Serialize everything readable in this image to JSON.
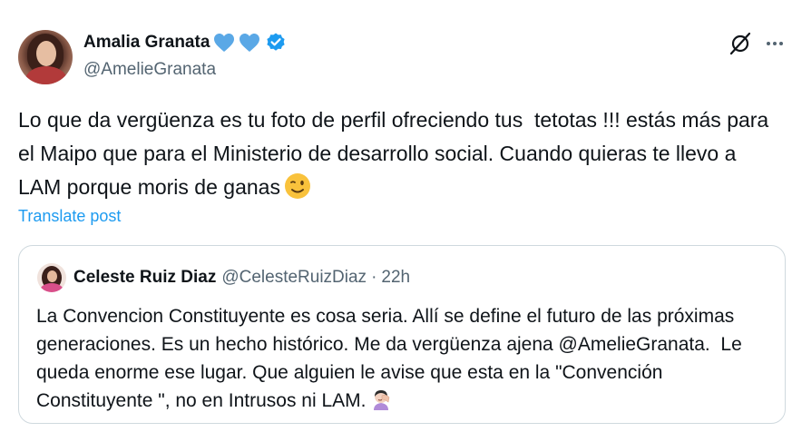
{
  "author": {
    "name": "Amalia Granata",
    "handle": "@AmelieGranata",
    "badges": [
      "blue-heart-icon",
      "blue-heart-icon",
      "verified-badge-icon"
    ]
  },
  "post": {
    "text": "Lo que da vergüenza es tu foto de perfil ofreciendo tus  tetotas !!! estás más para el Maipo que para el Ministerio de desarrollo social. Cuando quieras te llevo a LAM porque moris de ganas",
    "emoji": "winking-face-icon",
    "translate_label": "Translate post"
  },
  "quoted": {
    "name": "Celeste Ruiz Diaz",
    "handle": "@CelesteRuizDiaz",
    "separator": "·",
    "time": "22h",
    "text": "La Convencion Constituyente es cosa seria. Allí se define el futuro de las próximas generaciones. Es un hecho histórico. Me da vergüenza ajena @AmelieGranata.  Le queda enorme ese lugar. Que alguien le avise que esta en la \"Convención Constituyente \", no en Intrusos ni LAM.",
    "emoji": "woman-facepalming-icon"
  },
  "colors": {
    "text": "#0f1419",
    "secondary": "#536471",
    "link": "#1d9bf0",
    "border": "#cfd9de",
    "heart": "#5aa8e6"
  }
}
